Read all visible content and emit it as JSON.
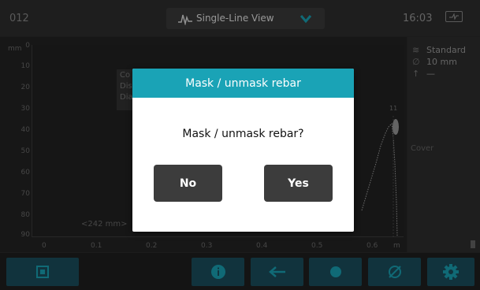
{
  "topbar": {
    "file_number": "012",
    "view_icon": "waveform-icon",
    "view_label": "Single-Line View",
    "clock": "16:03",
    "battery_icon": "battery-charging-icon"
  },
  "chart": {
    "y_unit": "mm",
    "y_ticks": [
      "0",
      "10",
      "20",
      "30",
      "40",
      "50",
      "60",
      "70",
      "80",
      "90"
    ],
    "x_ticks": [
      "0",
      "0.1",
      "0.2",
      "0.3",
      "0.4",
      "0.5",
      "0.6"
    ],
    "x_unit": "m",
    "distance_note": "<242 mm>",
    "peak_label": "11",
    "info_lines": [
      "Co",
      "Dis",
      "Dia"
    ]
  },
  "side_panel": {
    "mode": "Standard",
    "diameter": "10 mm",
    "depth": "—",
    "cover_label": "Cover"
  },
  "dialog": {
    "title": "Mask / unmask rebar",
    "message": "Mask / unmask rebar?",
    "no_label": "No",
    "yes_label": "Yes",
    "header_color": "#1aa3b6"
  },
  "toolbar": {
    "buttons": [
      "fit-screen-icon",
      "info-icon",
      "arrow-left-icon",
      "dot-icon",
      "diameter-icon",
      "gear-icon"
    ],
    "accent": "#1b4f5f"
  }
}
